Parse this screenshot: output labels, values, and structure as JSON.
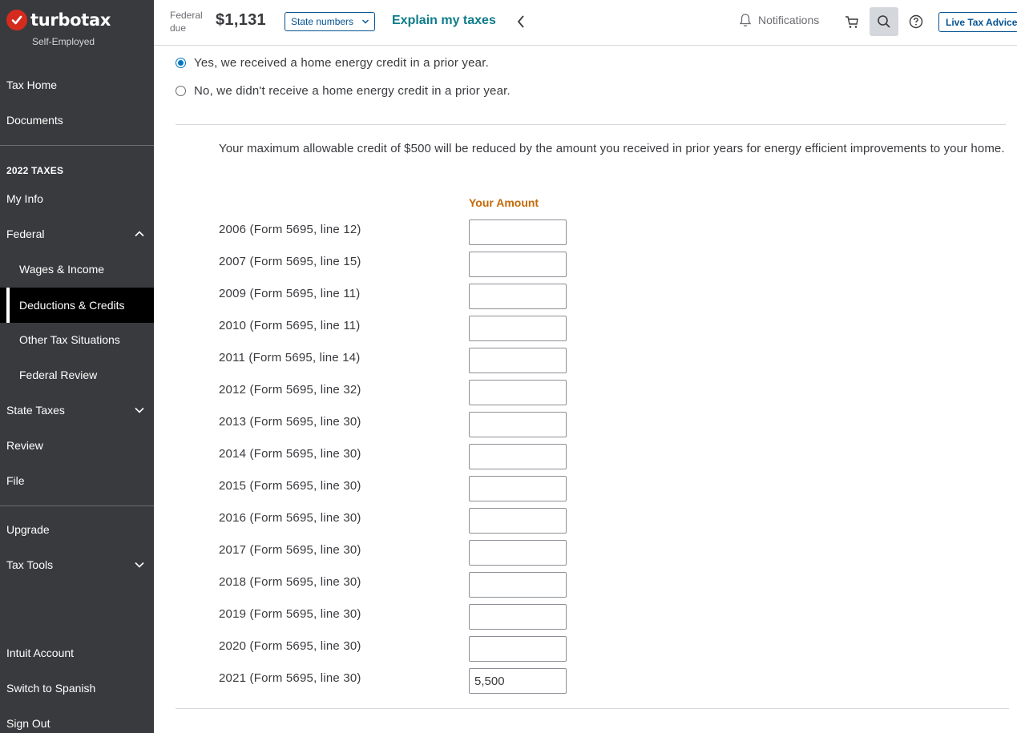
{
  "app": {
    "brand": "turbotax",
    "edition": "Self-Employed",
    "brand_color": "#d52b1e"
  },
  "sidebar": {
    "top_items": [
      {
        "label": "Tax Home"
      },
      {
        "label": "Documents"
      }
    ],
    "section_heading": "2022 TAXES",
    "items": [
      {
        "label": "My Info"
      },
      {
        "label": "Federal",
        "expanded": true,
        "icon": "chevron-up-icon"
      },
      {
        "label": "Wages & Income"
      },
      {
        "label": "Deductions & Credits",
        "active": true
      },
      {
        "label": "Other Tax Situations"
      },
      {
        "label": "Federal Review"
      },
      {
        "label": "State Taxes",
        "icon": "chevron-down-icon"
      },
      {
        "label": "Review"
      },
      {
        "label": "File"
      }
    ],
    "tool_items": [
      {
        "label": "Upgrade"
      },
      {
        "label": "Tax Tools",
        "icon": "chevron-down-icon"
      }
    ],
    "account_items": [
      {
        "label": "Intuit Account"
      },
      {
        "label": "Switch to Spanish"
      },
      {
        "label": "Sign Out"
      }
    ]
  },
  "topbar": {
    "federal_due_label_1": "Federal",
    "federal_due_label_2": "due",
    "federal_due_amount": "$1,131",
    "state_numbers": "State numbers",
    "explain_link": "Explain my taxes",
    "notifications": "Notifications",
    "live_advice": "Live Tax Advice"
  },
  "question": {
    "options": [
      {
        "label": "Yes, we received a home energy credit in a prior year.",
        "selected": true
      },
      {
        "label": "No, we didn't receive a home energy credit in a prior year.",
        "selected": false
      }
    ]
  },
  "credit_table": {
    "info_text": "Your maximum allowable credit of $500 will be reduced by the amount you received in prior years for energy efficient improvements to your home.",
    "column_header": "Your Amount",
    "header_color": "#c56a09",
    "rows": [
      {
        "label": "2006 (Form 5695, line 12)",
        "value": ""
      },
      {
        "label": "2007 (Form 5695, line 15)",
        "value": ""
      },
      {
        "label": "2009 (Form 5695, line 11)",
        "value": ""
      },
      {
        "label": "2010 (Form 5695, line 11)",
        "value": ""
      },
      {
        "label": "2011 (Form 5695, line 14)",
        "value": ""
      },
      {
        "label": "2012 (Form 5695, line 32)",
        "value": ""
      },
      {
        "label": "2013 (Form 5695, line 30)",
        "value": ""
      },
      {
        "label": "2014 (Form 5695, line 30)",
        "value": ""
      },
      {
        "label": "2015 (Form 5695, line 30)",
        "value": ""
      },
      {
        "label": "2016 (Form 5695, line 30)",
        "value": ""
      },
      {
        "label": "2017 (Form 5695, line 30)",
        "value": ""
      },
      {
        "label": "2018 (Form 5695, line 30)",
        "value": ""
      },
      {
        "label": "2019 (Form 5695, line 30)",
        "value": ""
      },
      {
        "label": "2020 (Form 5695, line 30)",
        "value": ""
      },
      {
        "label": "2021 (Form 5695, line 30)",
        "value": "5,500"
      }
    ]
  }
}
